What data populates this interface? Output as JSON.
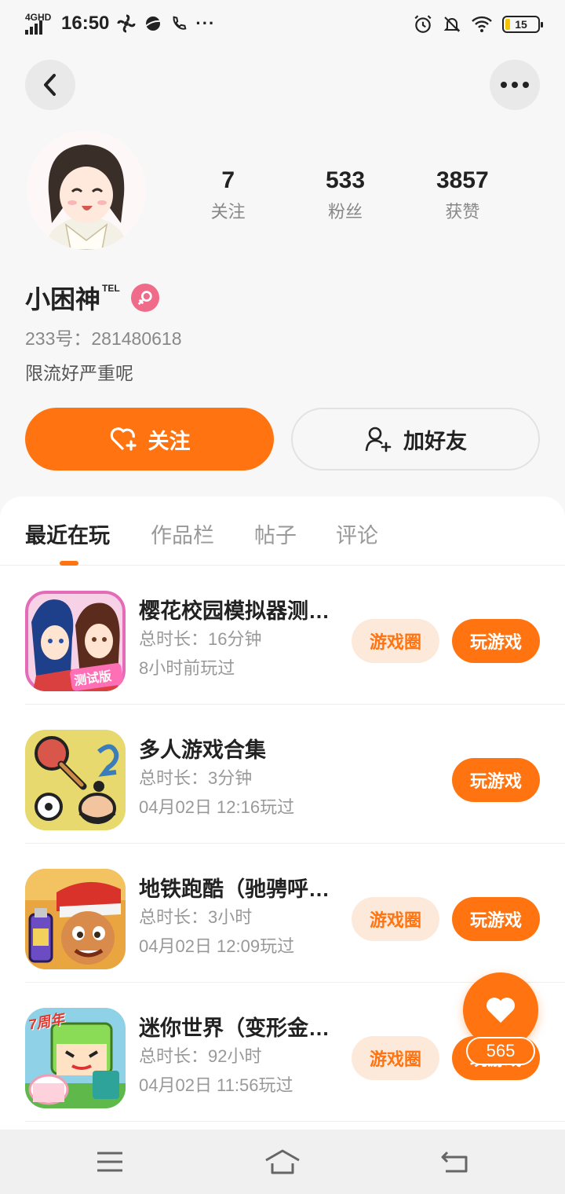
{
  "status_bar": {
    "network": "4GHD",
    "time": "16:50",
    "battery": "15"
  },
  "profile": {
    "stats": [
      {
        "value": "7",
        "label": "关注"
      },
      {
        "value": "533",
        "label": "粉丝"
      },
      {
        "value": "3857",
        "label": "获赞"
      }
    ],
    "name": "小困神",
    "name_suffix": "TEL",
    "uid": "233号：281480618",
    "bio": "限流好严重呢",
    "follow_label": "关注",
    "add_friend_label": "加好友"
  },
  "tabs": [
    "最近在玩",
    "作品栏",
    "帖子",
    "评论"
  ],
  "games": [
    {
      "title": "樱花校园模拟器测试版",
      "duration": "总时长：16分钟",
      "played": "8小时前玩过",
      "circle_label": "游戏圈",
      "play_label": "玩游戏",
      "icon": "sakura-school-icon",
      "icon_badge": "测试版"
    },
    {
      "title": "多人游戏合集",
      "duration": "总时长：3分钟",
      "played": "04月02日 12:16玩过",
      "circle_label": "",
      "play_label": "玩游戏",
      "icon": "multiplayer-collection-icon"
    },
    {
      "title": "地铁跑酷（驰骋呼伦贝尔）",
      "duration": "总时长：3小时",
      "played": "04月02日 12:09玩过",
      "circle_label": "游戏圈",
      "play_label": "玩游戏",
      "icon": "subway-surfers-icon"
    },
    {
      "title": "迷你世界（变形金刚）",
      "duration": "总时长：92小时",
      "played": "04月02日 11:56玩过",
      "circle_label": "游戏圈",
      "play_label": "玩游戏",
      "icon": "mini-world-icon",
      "icon_badge": "7周年"
    }
  ],
  "like_fab": {
    "count": "565",
    "icon": "heart-icon"
  },
  "colors": {
    "accent": "#ff7410",
    "accent_light": "#fde9da",
    "text": "#222222",
    "muted": "#999999",
    "female_badge": "#f06b8a"
  }
}
